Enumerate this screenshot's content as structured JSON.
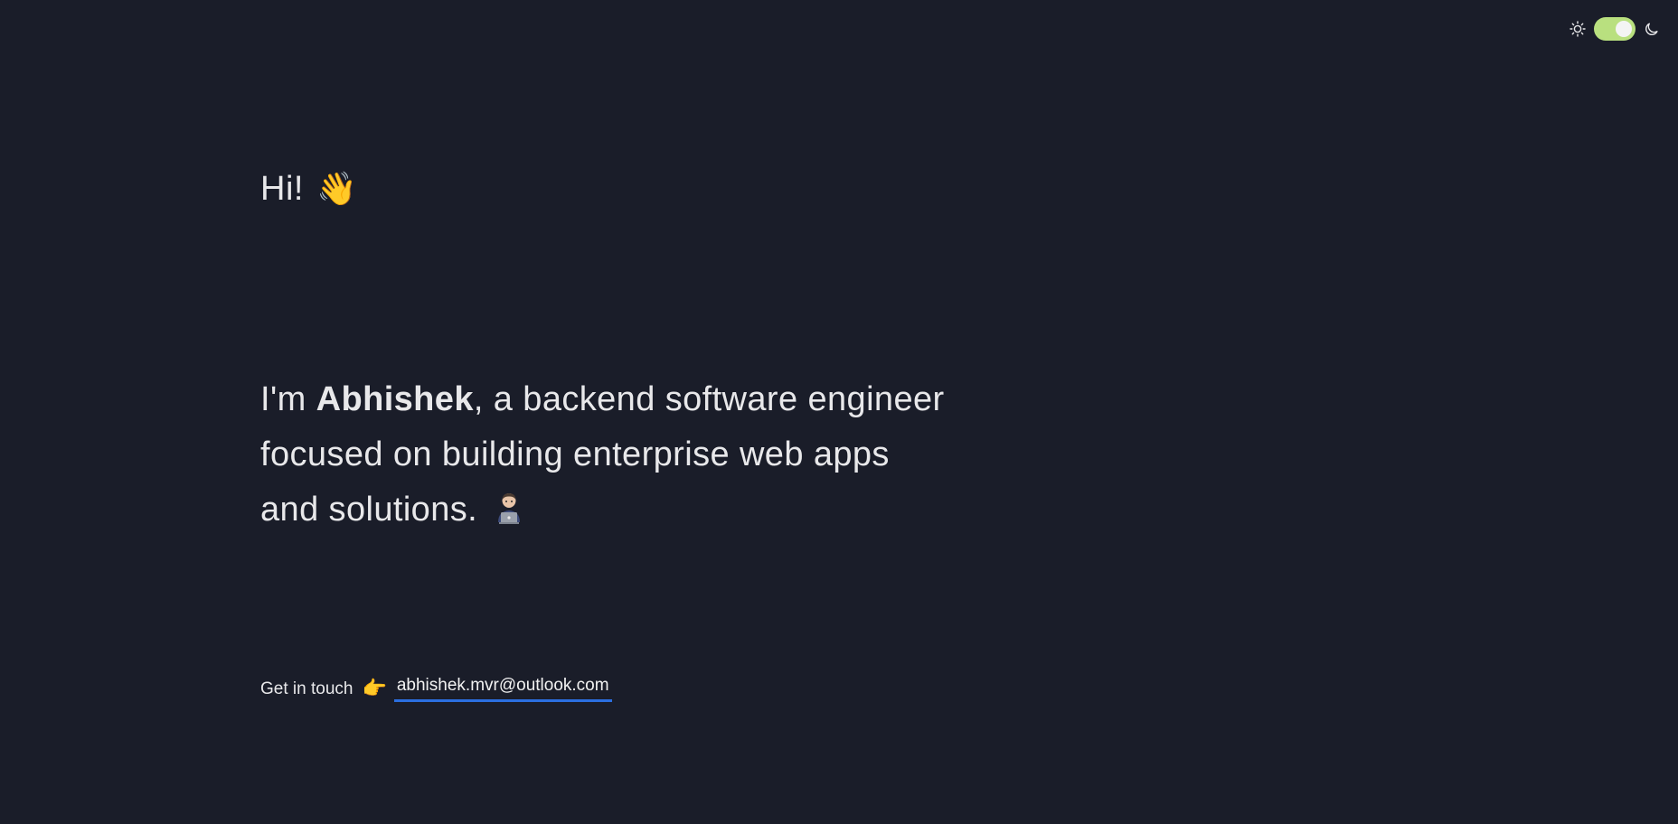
{
  "theme": {
    "mode": "dark",
    "toggle_on": true,
    "icons": {
      "light": "sun-icon",
      "dark": "moon-icon"
    },
    "colors": {
      "background": "#1a1d29",
      "toggle_track": "#b9e07f",
      "link_underline": "#2b6fe0"
    }
  },
  "greeting": {
    "text": "Hi!",
    "emoji": "👋"
  },
  "intro": {
    "prefix": "I'm ",
    "name": "Abhishek",
    "rest": ", a backend software engineer focused on building enterprise web apps and solutions.",
    "icon": "technologist-emoji"
  },
  "contact": {
    "label": "Get in touch",
    "emoji": "👉",
    "email": "abhishek.mvr@outlook.com"
  }
}
